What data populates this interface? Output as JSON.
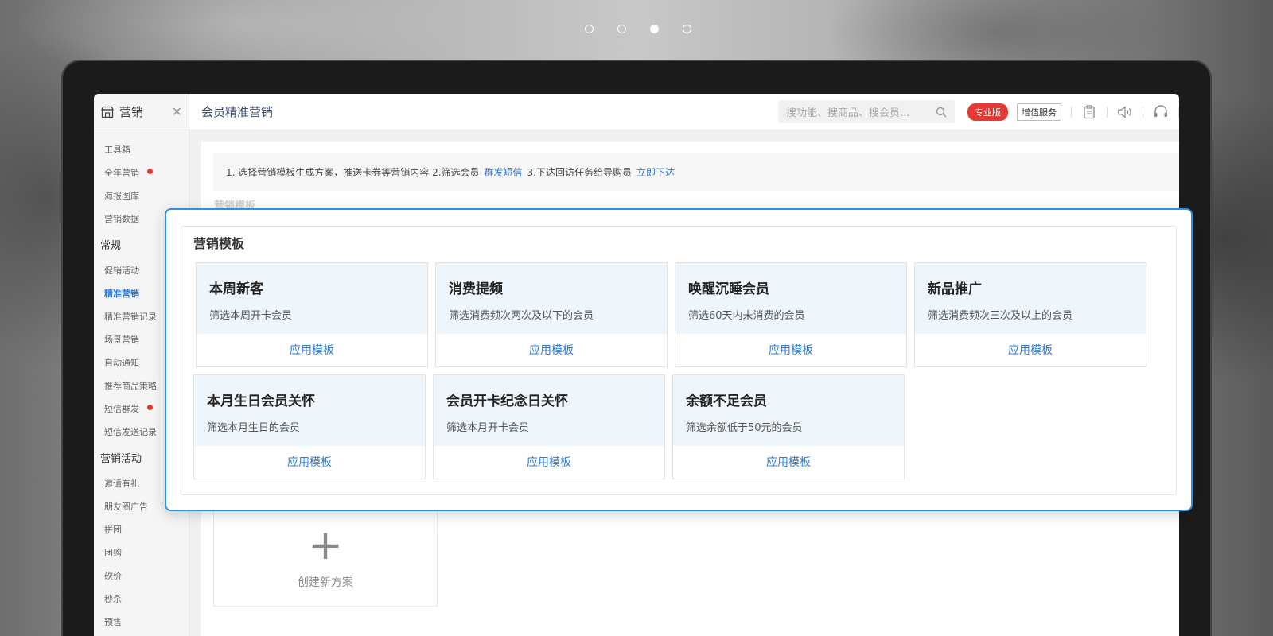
{
  "carousel": {
    "count": 4,
    "active_index": 2
  },
  "sidebar": {
    "title": "营销",
    "icon": "store-icon",
    "top_items": [
      {
        "label": "工具箱",
        "dot": false
      },
      {
        "label": "全年营销",
        "dot": true
      },
      {
        "label": "海报图库",
        "dot": false
      },
      {
        "label": "营销数据",
        "dot": false
      }
    ],
    "group1": "常规",
    "group1_items": [
      {
        "label": "促销活动",
        "dot": false,
        "active": false
      },
      {
        "label": "精准营销",
        "dot": false,
        "active": true
      },
      {
        "label": "精准营销记录",
        "dot": false,
        "active": false
      },
      {
        "label": "场景营销",
        "dot": false,
        "active": false
      },
      {
        "label": "自动通知",
        "dot": false,
        "active": false
      },
      {
        "label": "推荐商品策略",
        "dot": false,
        "active": false
      },
      {
        "label": "短信群发",
        "dot": true,
        "active": false
      },
      {
        "label": "短信发送记录",
        "dot": false,
        "active": false
      }
    ],
    "group2": "营销活动",
    "group2_items": [
      {
        "label": "邀请有礼"
      },
      {
        "label": "朋友圈广告"
      },
      {
        "label": "拼团"
      },
      {
        "label": "团购"
      },
      {
        "label": "砍价"
      },
      {
        "label": "秒杀"
      },
      {
        "label": "预售"
      }
    ]
  },
  "topbar": {
    "page_title": "会员精准营销",
    "search_placeholder": "搜功能、搜商品、搜会员...",
    "pro_badge": "专业版",
    "vas_label": "增值服务",
    "pro_color": "#e53935"
  },
  "notice": {
    "text1": "1. 选择营销模板生成方案，推送卡券等营销内容 2.筛选会员",
    "link1": "群发短信",
    "text2": "3.下达回访任务给导购员",
    "link2": "立即下达"
  },
  "ghost_title": "营销模板",
  "create_card": {
    "label": "创建新方案"
  },
  "panel": {
    "title": "营销模板",
    "cards": [
      {
        "name": "本周新客",
        "desc": "筛选本周开卡会员",
        "apply": "应用模板"
      },
      {
        "name": "消费提频",
        "desc": "筛选消费频次两次及以下的会员",
        "apply": "应用模板"
      },
      {
        "name": "唤醒沉睡会员",
        "desc": "筛选60天内未消费的会员",
        "apply": "应用模板"
      },
      {
        "name": "新品推广",
        "desc": "筛选消费频次三次及以上的会员",
        "apply": "应用模板"
      },
      {
        "name": "本月生日会员关怀",
        "desc": "筛选本月生日的会员",
        "apply": "应用模板"
      },
      {
        "name": "会员开卡纪念日关怀",
        "desc": "筛选本月开卡会员",
        "apply": "应用模板"
      },
      {
        "name": "余额不足会员",
        "desc": "筛选余额低于50元的会员",
        "apply": "应用模板"
      }
    ]
  },
  "accent_color": "#2f7bd9"
}
